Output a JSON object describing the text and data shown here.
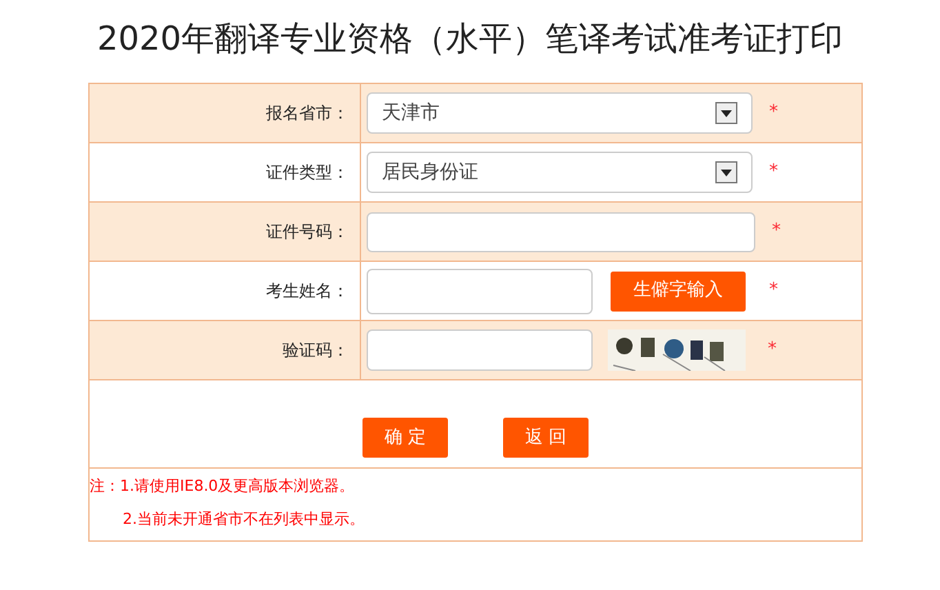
{
  "title": "2020年翻译专业资格（水平）笔译考试准考证打印",
  "fields": [
    {
      "kind": "select",
      "label": "报名省市：",
      "value": "天津市",
      "required_mark": "*"
    },
    {
      "kind": "select",
      "label": "证件类型：",
      "value": "居民身份证",
      "required_mark": "*"
    },
    {
      "kind": "input",
      "label": "证件号码：",
      "required_mark": "*"
    },
    {
      "kind": "input_button",
      "label": "考生姓名：",
      "button": "生僻字输入",
      "required_mark": "*"
    },
    {
      "kind": "captcha",
      "label": "验证码：",
      "required_mark": "*"
    }
  ],
  "buttons": [
    "确 定",
    "返 回"
  ],
  "notes": [
    {
      "prefix": "注：",
      "text": "1.请使用IE8.0及更高版本浏览器。"
    },
    {
      "text": "2.当前未开通省市不在列表中显示。"
    }
  ]
}
